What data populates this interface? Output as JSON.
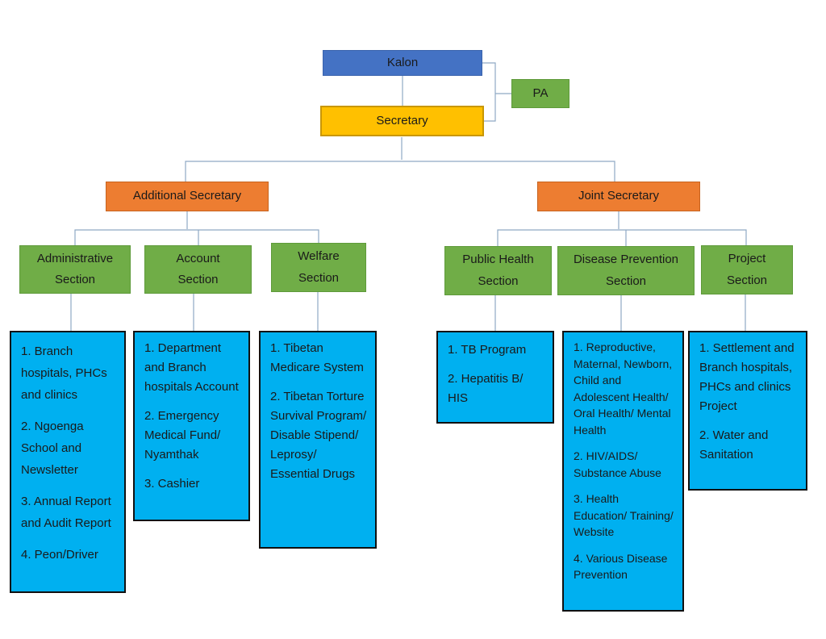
{
  "top": {
    "kalon": "Kalon",
    "secretary": "Secretary",
    "pa": "PA"
  },
  "level2": {
    "additional": "Additional Secretary",
    "joint": "Joint Secretary"
  },
  "sections": [
    {
      "line1": "Administrative",
      "line2": "Section"
    },
    {
      "line1": "Account",
      "line2": "Section"
    },
    {
      "line1": "Welfare",
      "line2": "Section"
    },
    {
      "line1": "Public Health",
      "line2": "Section"
    },
    {
      "line1": "Disease Prevention",
      "line2": "Section"
    },
    {
      "line1": "Project",
      "line2": "Section"
    }
  ],
  "lists": [
    [
      "1. Branch hospitals, PHCs and clinics",
      "2. Ngoenga School and Newsletter",
      "3. Annual Report and Audit Report",
      "4. Peon/Driver"
    ],
    [
      "1. Department and Branch hospitals Account",
      "2. Emergency Medical Fund/ Nyamthak",
      "3. Cashier"
    ],
    [
      "1. Tibetan Medicare System",
      "2. Tibetan Torture Survival Program/ Disable Stipend/ Leprosy/ Essential Drugs"
    ],
    [
      "1. TB Program",
      "2. Hepatitis B/ HIS"
    ],
    [
      "1. Reproductive, Maternal, Newborn, Child and Adolescent Health/ Oral Health/ Mental Health",
      "2. HIV/AIDS/ Substance Abuse",
      "3. Health Education/ Training/ Website",
      "4. Various Disease Prevention"
    ],
    [
      "1. Settlement and Branch hospitals, PHCs and clinics Project",
      "2. Water and Sanitation"
    ]
  ],
  "colors": {
    "kalon": "#4472c4",
    "secretary": "#ffc000",
    "pa": "#70ad47",
    "secretaries": "#ed7d31",
    "sections": "#70ad47",
    "lists": "#00b0f0",
    "connector": "#8fa9c4"
  }
}
